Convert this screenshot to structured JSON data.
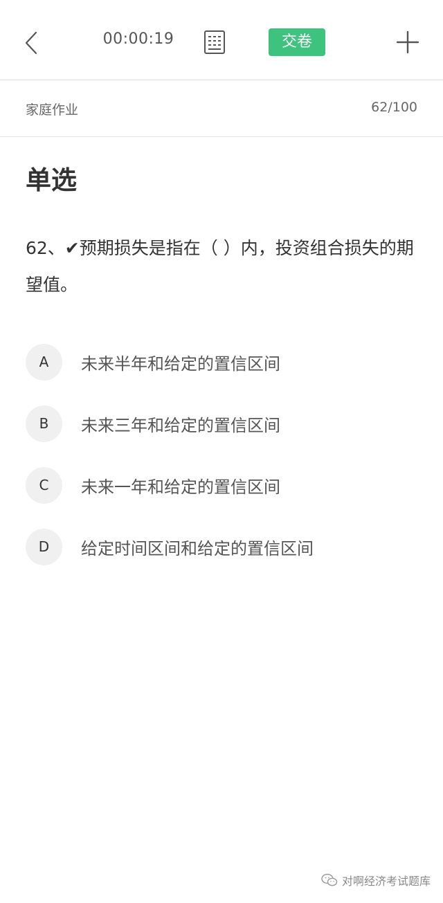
{
  "header": {
    "timer": "00:00:19",
    "submit_label": "交卷",
    "back_icon": "chevron-left-icon",
    "sheet_icon": "answer-sheet-icon",
    "add_icon": "plus-icon",
    "accent_color": "#3ec37e"
  },
  "subheader": {
    "category": "家庭作业",
    "progress": "62/100"
  },
  "question": {
    "type": "单选",
    "text": "62、✔预期损失是指在（  ）内，投资组合损失的期望值。",
    "options": [
      {
        "letter": "A",
        "text": "未来半年和给定的置信区间"
      },
      {
        "letter": "B",
        "text": "未来三年和给定的置信区间"
      },
      {
        "letter": "C",
        "text": "未来一年和给定的置信区间"
      },
      {
        "letter": "D",
        "text": "给定时间区间和给定的置信区间"
      }
    ]
  },
  "watermark": {
    "text": "对啊经济考试题库",
    "icon": "wechat-icon"
  }
}
